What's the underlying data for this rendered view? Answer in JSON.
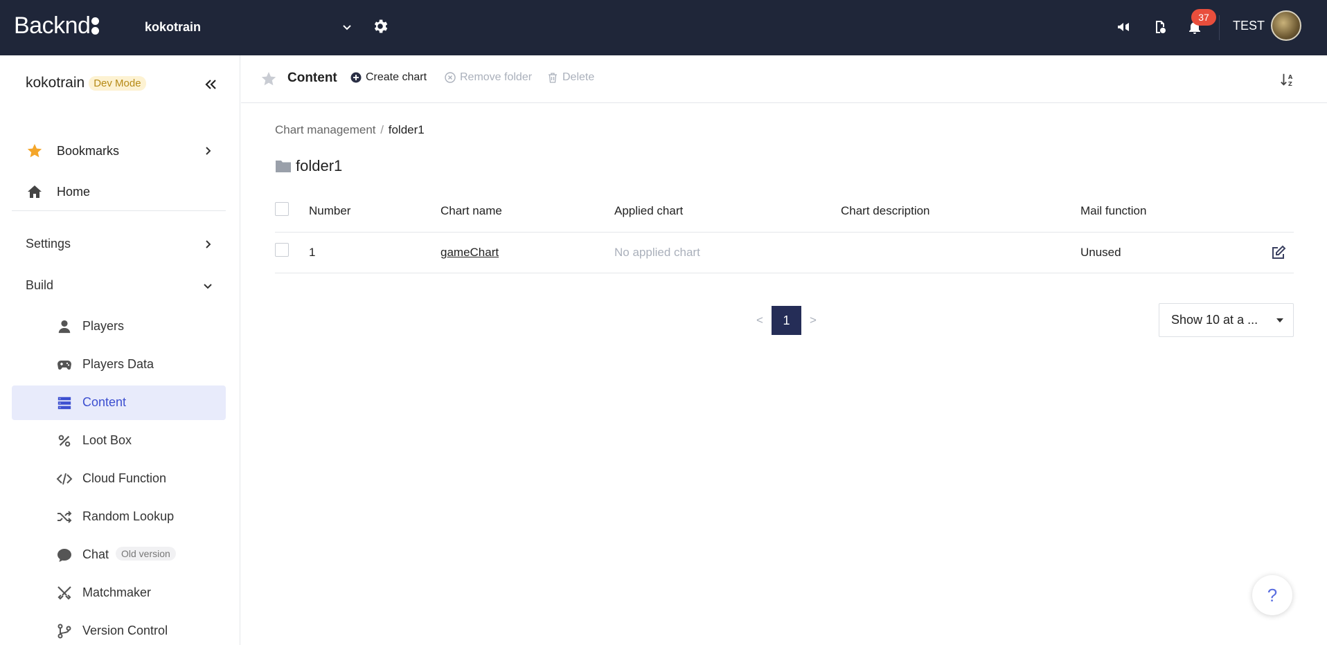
{
  "header": {
    "logo_text": "Backnd",
    "project_name": "kokotrain",
    "notification_count": "37",
    "user_name": "TEST"
  },
  "sidebar": {
    "project_name": "kokotrain",
    "mode_badge": "Dev Mode",
    "top_items": [
      {
        "label": "Bookmarks",
        "icon": "star-icon"
      },
      {
        "label": "Home",
        "icon": "home-icon"
      }
    ],
    "sections": [
      {
        "label": "Settings"
      },
      {
        "label": "Build"
      }
    ],
    "build_items": [
      {
        "label": "Players",
        "icon": "user-icon"
      },
      {
        "label": "Players Data",
        "icon": "gamepad-icon"
      },
      {
        "label": "Content",
        "icon": "list-icon",
        "active": true
      },
      {
        "label": "Loot Box",
        "icon": "percent-icon"
      },
      {
        "label": "Cloud Function",
        "icon": "code-icon"
      },
      {
        "label": "Random Lookup",
        "icon": "shuffle-icon"
      },
      {
        "label": "Chat",
        "icon": "chat-icon",
        "tag": "Old version"
      },
      {
        "label": "Matchmaker",
        "icon": "swords-icon"
      },
      {
        "label": "Version Control",
        "icon": "branch-icon"
      }
    ]
  },
  "toolbar": {
    "title": "Content",
    "create_chart": "Create chart",
    "remove_folder": "Remove folder",
    "delete": "Delete"
  },
  "breadcrumb": {
    "root": "Chart management",
    "separator": "/",
    "current": "folder1"
  },
  "folder": {
    "name": "folder1"
  },
  "table": {
    "columns": [
      "Number",
      "Chart name",
      "Applied chart",
      "Chart description",
      "Mail function"
    ],
    "rows": [
      {
        "number": "1",
        "chart_name": "gameChart",
        "applied_chart": "No applied chart",
        "chart_description": "",
        "mail_function": "Unused"
      }
    ]
  },
  "pagination": {
    "prev": "<",
    "current_page": "1",
    "next": ">",
    "page_size": "Show 10 at a ..."
  },
  "help": {
    "label": "?"
  },
  "colors": {
    "header_bg": "#1f2639",
    "accent": "#3c4fd0",
    "active_bg": "#e8ebfb",
    "badge": "#e84e3c",
    "pager_active": "#252d57",
    "bookmark_star": "#f4a62a"
  }
}
